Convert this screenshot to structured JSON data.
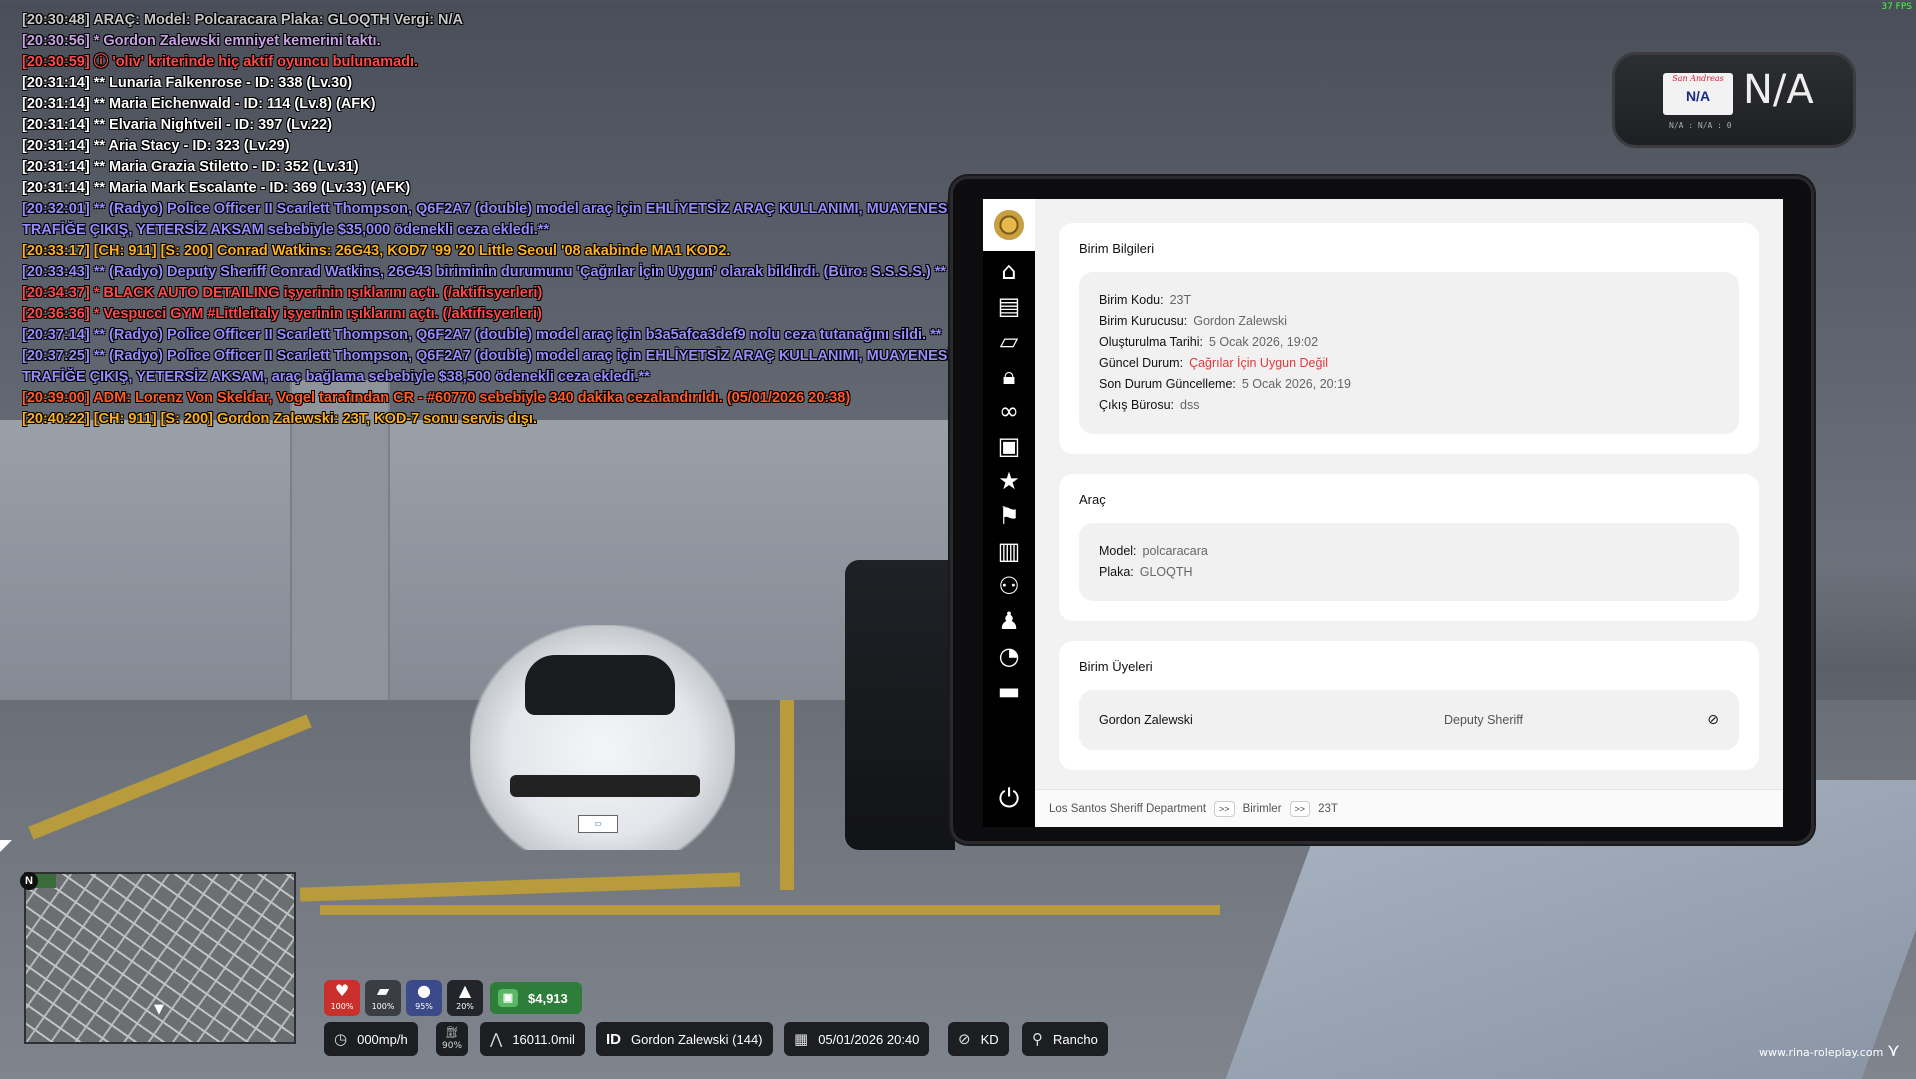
{
  "hud": {
    "fps": "37 FPS",
    "plate": {
      "state": "San Andreas",
      "number": "N/A",
      "big": "N/A",
      "sub": "N/A : N/A : 0"
    },
    "stats": [
      {
        "icon": "heart-icon",
        "glyph": "♥",
        "value": "100%",
        "color": "#c9302c"
      },
      {
        "icon": "shield-icon",
        "glyph": "▰",
        "value": "100%",
        "color": "#3a3d44"
      },
      {
        "icon": "hunger-icon",
        "glyph": "●",
        "value": "95%",
        "color": "#3b4a8a"
      },
      {
        "icon": "thirst-icon",
        "glyph": "▲",
        "value": "20%",
        "color": "#23252a"
      }
    ],
    "money": "$4,913",
    "speed": "000mp/h",
    "fuel": "90%",
    "odometer": "16011.0mil",
    "id_label": "ID",
    "player": "Gordon Zalewski (144)",
    "datetime": "05/01/2026 20:40",
    "direction": "KD",
    "location": "Rancho",
    "north": "N",
    "watermark": "www.rina-roleplay.com"
  },
  "chat": [
    {
      "text": "[20:30:48] ARAÇ: Model: Polcaracara Plaka: GLOQTH Vergi: N/A",
      "color": "#c8c8c8"
    },
    {
      "text": "[20:30:56] * Gordon Zalewski emniyet kemerini taktı.",
      "color": "#c9a3e6"
    },
    {
      "text": "[20:30:59] ⓘ 'oliv' kriterinde hiç aktif oyuncu bulunamadı.",
      "color": "#ff4a4a"
    },
    {
      "text": "[20:31:14] ** Lunaria Falkenrose - ID: 338 (Lv.30)",
      "color": "#ffffff"
    },
    {
      "text": "[20:31:14] ** Maria Eichenwald - ID: 114 (Lv.8) (AFK)",
      "color": "#ffffff"
    },
    {
      "text": "[20:31:14] ** Elvaria Nightveil - ID: 397 (Lv.22)",
      "color": "#ffffff"
    },
    {
      "text": "[20:31:14] ** Aria Stacy - ID: 323 (Lv.29)",
      "color": "#ffffff"
    },
    {
      "text": "[20:31:14] ** Maria Grazia Stiletto - ID: 352 (Lv.31)",
      "color": "#ffffff"
    },
    {
      "text": "[20:31:14] ** Maria Mark Escalante - ID: 369 (Lv.33) (AFK)",
      "color": "#ffffff"
    },
    {
      "text": "[20:32:01] ** (Radyo) Police Officer II Scarlett Thompson, Q6F2A7 (double) model araç için EHLİYETSİZ ARAÇ KULLANIMI, MUAYENESİZ",
      "color": "#9a8cff"
    },
    {
      "text": "TRAFİĞE ÇIKIŞ, YETERSİZ AKSAM sebebiyle $35,000 ödenekli ceza ekledi.**",
      "color": "#9a8cff"
    },
    {
      "text": "[20:33:17] [CH: 911] [S: 200] Conrad Watkins: 26G43, KOD7 '99 '20 Little Seoul '08 akabinde MA1 KOD2.",
      "color": "#ffb020"
    },
    {
      "text": "[20:33:43] ** (Radyo) Deputy Sheriff Conrad Watkins, 26G43 biriminin durumunu 'Çağrılar İçin Uygun' olarak bildirdi. (Büro: S.S.S.S.) **",
      "color": "#9a8cff"
    },
    {
      "text": "[20:34:37] * BLACK AUTO DETAILING işyerinin ışıklarını açtı. (/aktifisyerleri)",
      "color": "#ff4a4a"
    },
    {
      "text": "[20:36:36] * Vespucci GYM #Littleitaly işyerinin ışıklarını açtı. (/aktifisyerleri)",
      "color": "#ff4a4a"
    },
    {
      "text": "[20:37:14] ** (Radyo) Police Officer II Scarlett Thompson, Q6F2A7 (double) model araç için b3a5afca3def9 nolu ceza tutanağını sildi. **",
      "color": "#9a8cff"
    },
    {
      "text": "[20:37:25] ** (Radyo) Police Officer II Scarlett Thompson, Q6F2A7 (double) model araç için EHLİYETSİZ ARAÇ KULLANIMI, MUAYENESİZ",
      "color": "#9a8cff"
    },
    {
      "text": "TRAFİĞE ÇIKIŞ, YETERSİZ AKSAM, araç bağlama sebebiyle $38,500 ödenekli ceza ekledi.**",
      "color": "#9a8cff"
    },
    {
      "text": "[20:39:00] ADM: Lorenz Von Skeldar, Vogel tarafından CR - #60770 sebebiyle 340 dakika cezalandırıldı. (05/01/2026 20:38)",
      "color": "#ff5a2a"
    },
    {
      "text": "[20:40:22] [CH: 911] [S: 200] Gordon Zalewski: 23T, KOD-7 sonu servis dışı.",
      "color": "#ffb020"
    }
  ],
  "tablet": {
    "sidebar": [
      {
        "name": "home-icon",
        "glyph": "⌂"
      },
      {
        "name": "book-icon",
        "glyph": "▤"
      },
      {
        "name": "folder-open-icon",
        "glyph": "▱"
      },
      {
        "name": "lock-icon",
        "glyph": "🔒︎"
      },
      {
        "name": "binoculars-icon",
        "glyph": "∞"
      },
      {
        "name": "briefcase-icon",
        "glyph": "▣"
      },
      {
        "name": "star-icon",
        "glyph": "★"
      },
      {
        "name": "flag-icon",
        "glyph": "⚑"
      },
      {
        "name": "suitcase-icon",
        "glyph": "▥"
      },
      {
        "name": "users-icon",
        "glyph": "⚇"
      },
      {
        "name": "user-icon",
        "glyph": "♟"
      },
      {
        "name": "dashboard-icon",
        "glyph": "◔"
      },
      {
        "name": "archive-icon",
        "glyph": "▬"
      }
    ],
    "power_glyph": "⏻",
    "unit_info": {
      "title": "Birim Bilgileri",
      "rows": [
        {
          "label": "Birim Kodu:",
          "value": "23T"
        },
        {
          "label": "Birim Kurucusu:",
          "value": "Gordon Zalewski"
        },
        {
          "label": "Oluşturulma Tarihi:",
          "value": "5 Ocak 2026, 19:02"
        },
        {
          "label": "Güncel Durum:",
          "value": "Çağrılar İçin Uygun Değil"
        },
        {
          "label": "Son Durum Güncelleme:",
          "value": "5 Ocak 2026, 20:19"
        },
        {
          "label": "Çıkış Bürosu:",
          "value": "dss"
        }
      ]
    },
    "vehicle": {
      "title": "Araç",
      "rows": [
        {
          "label": "Model:",
          "value": "polcaracara"
        },
        {
          "label": "Plaka:",
          "value": "GLOQTH"
        }
      ]
    },
    "members": {
      "title": "Birim Üyeleri",
      "list": [
        {
          "name": "Gordon Zalewski",
          "rank": "Deputy Sheriff",
          "action_glyph": "⊘"
        }
      ]
    },
    "breadcrumb": {
      "items": [
        "Los Santos Sheriff Department",
        "Birimler",
        "23T"
      ],
      "sep": ">>"
    },
    "status_color": "#e03a3a"
  }
}
